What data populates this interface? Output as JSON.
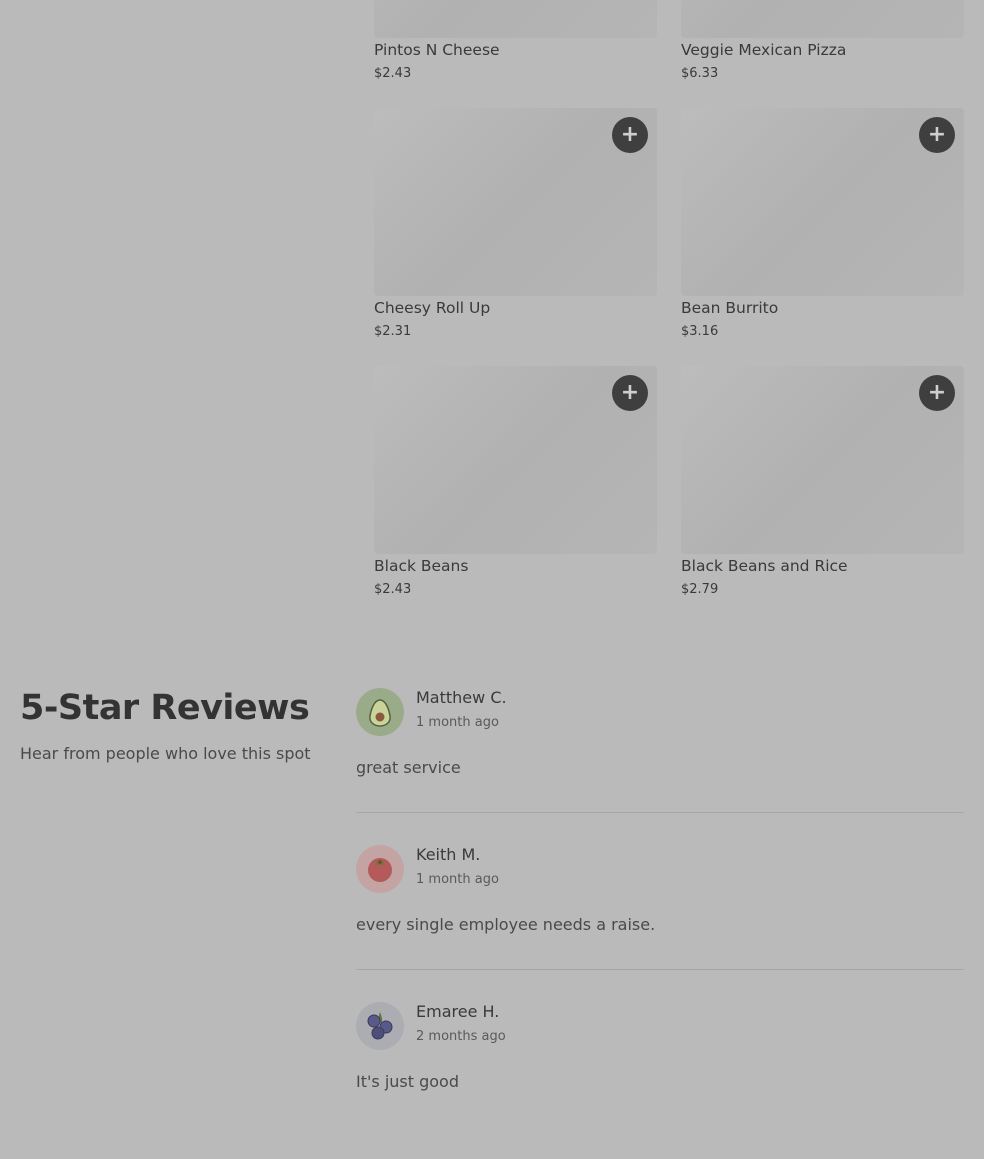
{
  "menu": {
    "add_symbol": "+",
    "items": [
      {
        "name": "Pintos N Cheese",
        "price": "$2.43"
      },
      {
        "name": "Veggie Mexican Pizza",
        "price": "$6.33"
      },
      {
        "name": "Cheesy Roll Up",
        "price": "$2.31"
      },
      {
        "name": "Bean Burrito",
        "price": "$3.16"
      },
      {
        "name": "Black Beans",
        "price": "$2.43"
      },
      {
        "name": "Black Beans and Rice",
        "price": "$2.79"
      }
    ]
  },
  "reviews": {
    "title": "5-Star Reviews",
    "subtitle": "Hear from people who love this spot",
    "items": [
      {
        "name": "Matthew C.",
        "time": "1 month ago",
        "text": "great service",
        "avatar_icon": "avocado-icon",
        "avatar_bg": "#9aab8a"
      },
      {
        "name": "Keith M.",
        "time": "1 month ago",
        "text": "every single employee needs a raise.",
        "avatar_icon": "tomato-icon",
        "avatar_bg": "#c4a3a3"
      },
      {
        "name": "Emaree H.",
        "time": "2 months ago",
        "text": "It's just good",
        "avatar_icon": "blueberries-icon",
        "avatar_bg": "#acacb3"
      }
    ]
  },
  "colors": {
    "page_bg": "#bababa",
    "add_button": "#3f3f3f",
    "divider": "#a6a6a6"
  }
}
